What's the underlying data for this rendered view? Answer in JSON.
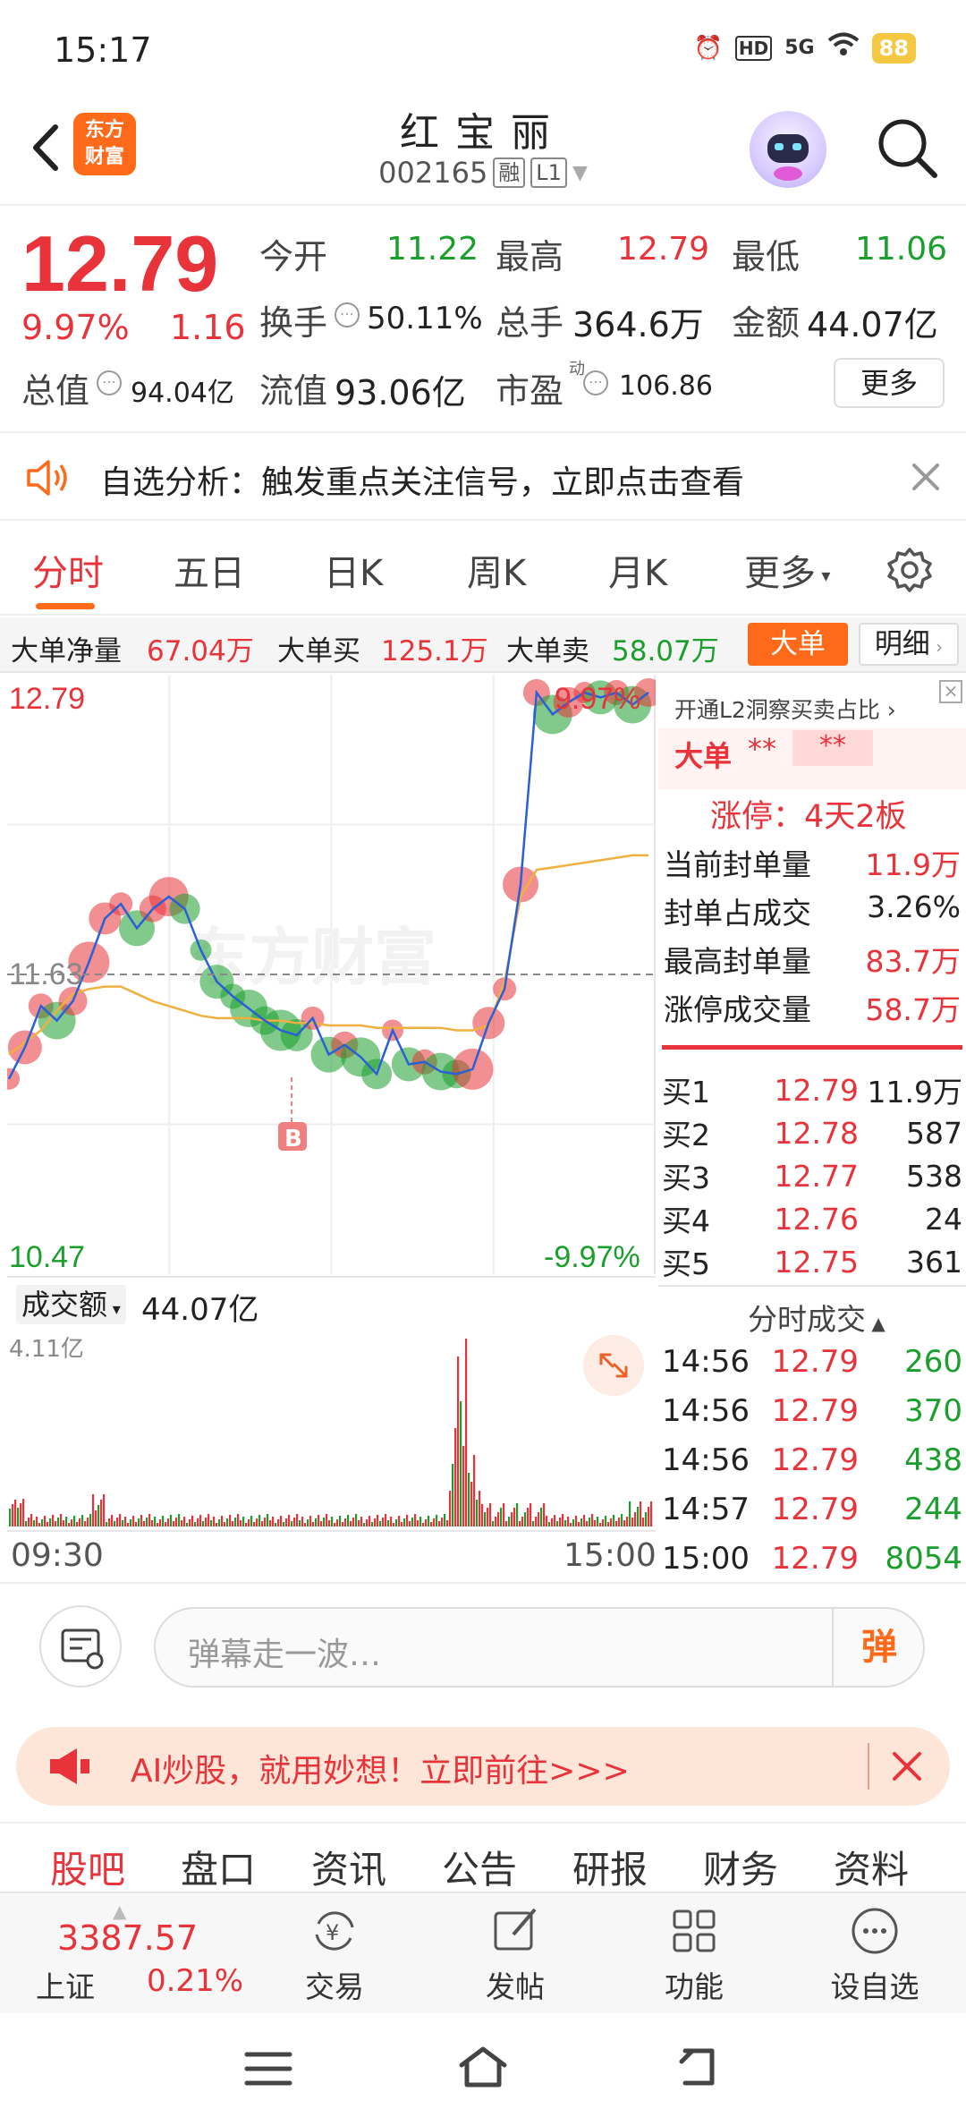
{
  "status": {
    "time": "15:17",
    "battery": "88",
    "net": "5G",
    "hd": "HD"
  },
  "header": {
    "logo_line1": "东方",
    "logo_line2": "财富",
    "name": "红宝丽",
    "code": "002165",
    "tag1": "融",
    "tag2": "L1"
  },
  "quote": {
    "price": "12.79",
    "pct": "9.97%",
    "change": "1.16",
    "open_label": "今开",
    "open": "11.22",
    "high_label": "最高",
    "high": "12.79",
    "low_label": "最低",
    "low": "11.06",
    "turnover_label": "换手",
    "turnover": "50.11%",
    "vol_label": "总手",
    "vol": "364.6万",
    "amount_label": "金额",
    "amount": "44.07亿",
    "mktcap_label": "总值",
    "mktcap": "94.04亿",
    "float_label": "流值",
    "float": "93.06亿",
    "pe_label": "市盈",
    "pe_sup": "动",
    "pe": "106.86",
    "more": "更多"
  },
  "banner": {
    "text": "自选分析：触发重点关注信号，立即点击查看"
  },
  "tabs": [
    "分时",
    "五日",
    "日K",
    "周K",
    "月K",
    "更多"
  ],
  "bigorder": {
    "net_label": "大单净量",
    "net": "67.04万",
    "buy_label": "大单买",
    "buy": "125.1万",
    "sell_label": "大单卖",
    "sell": "58.07万",
    "btn_big": "大单",
    "btn_detail": "明细"
  },
  "chart": {
    "top_price": "12.79",
    "top_pct": "9.97%",
    "mid_price": "11.63",
    "bottom_price": "10.47",
    "bottom_pct": "-9.97%",
    "b_marker": "B",
    "watermark": "东方财富"
  },
  "chart_data": {
    "type": "line",
    "x_start": "09:30",
    "x_end": "15:00",
    "ylim": [
      10.47,
      12.79
    ],
    "prev_close": 11.63,
    "price_series": [
      11.2,
      11.33,
      11.5,
      11.44,
      11.52,
      11.68,
      11.86,
      11.92,
      11.82,
      11.9,
      11.95,
      11.9,
      11.73,
      11.6,
      11.54,
      11.49,
      11.44,
      11.4,
      11.38,
      11.45,
      11.3,
      11.34,
      11.29,
      11.22,
      11.4,
      11.26,
      11.27,
      11.23,
      11.22,
      11.24,
      11.43,
      11.57,
      12.0,
      12.79,
      12.7,
      12.75,
      12.79,
      12.77,
      12.79,
      12.74,
      12.79
    ],
    "avg_series": [
      11.3,
      11.35,
      11.4,
      11.48,
      11.55,
      11.57,
      11.58,
      11.58,
      11.55,
      11.52,
      11.5,
      11.48,
      11.46,
      11.45,
      11.45,
      11.45,
      11.44,
      11.44,
      11.43,
      11.43,
      11.42,
      11.42,
      11.42,
      11.41,
      11.41,
      11.41,
      11.41,
      11.41,
      11.4,
      11.4,
      11.42,
      11.6,
      11.95,
      12.06,
      12.07,
      12.08,
      12.09,
      12.1,
      12.11,
      12.12,
      12.12
    ]
  },
  "volume": {
    "label": "成交额",
    "value": "44.07亿",
    "max_label": "4.11亿",
    "time_start": "09:30",
    "time_end": "15:00"
  },
  "right_panel": {
    "l2_text": "开通L2洞察买卖占比",
    "big_label": "大单",
    "big_mask1": "**",
    "big_mask2": "**",
    "limit_title": "涨停：4天2板",
    "stats": [
      {
        "label": "当前封单量",
        "value": "11.9万"
      },
      {
        "label": "封单占成交",
        "value": "3.26%"
      },
      {
        "label": "最高封单量",
        "value": "83.7万"
      },
      {
        "label": "涨停成交量",
        "value": "58.7万"
      }
    ],
    "bids": [
      {
        "label": "买1",
        "price": "12.79",
        "vol": "11.9万"
      },
      {
        "label": "买2",
        "price": "12.78",
        "vol": "587"
      },
      {
        "label": "买3",
        "price": "12.77",
        "vol": "538"
      },
      {
        "label": "买4",
        "price": "12.76",
        "vol": "24"
      },
      {
        "label": "买5",
        "price": "12.75",
        "vol": "361"
      }
    ],
    "ticks_title": "分时成交",
    "ticks": [
      {
        "time": "14:56",
        "price": "12.79",
        "vol": "260"
      },
      {
        "time": "14:56",
        "price": "12.79",
        "vol": "370"
      },
      {
        "time": "14:56",
        "price": "12.79",
        "vol": "438"
      },
      {
        "time": "14:57",
        "price": "12.79",
        "vol": "244"
      },
      {
        "time": "15:00",
        "price": "12.79",
        "vol": "8054"
      }
    ]
  },
  "comment": {
    "placeholder": "弹幕走一波…",
    "btn": "弹"
  },
  "ad": {
    "text": "AI炒股，就用妙想！立即前往>>>"
  },
  "bottom_tabs": [
    "股吧",
    "盘口",
    "资讯",
    "公告",
    "研报",
    "财务",
    "资料"
  ],
  "nav": {
    "index_value": "3387.57",
    "index_name": "上证",
    "index_pct": "0.21%",
    "trade": "交易",
    "post": "发帖",
    "func": "功能",
    "watch": "设自选"
  },
  "colors": {
    "up": "#e8333a",
    "down": "#1a9e2c",
    "accent": "#ff6a1a",
    "avg": "#f0b040",
    "price_line": "#2a5fd6"
  }
}
